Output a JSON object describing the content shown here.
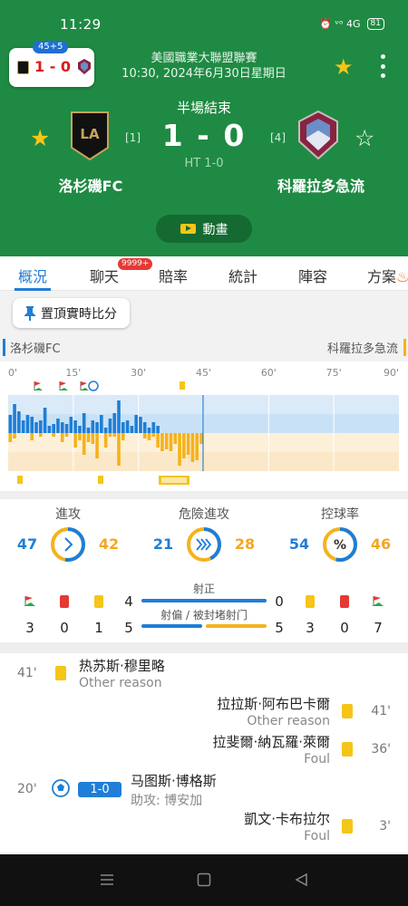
{
  "status_bar": {
    "time": "11:29",
    "icons": "⏰ ᵛᵒ 4G",
    "battery": "81"
  },
  "mini_card": {
    "badge": "45+5",
    "score": "1 - 0"
  },
  "match": {
    "competition": "美國職業大聯盟聯賽",
    "datetime": "10:30, 2024年6月30日星期日",
    "status": "半場結束",
    "score": "1 - 0",
    "halftime": "HT 1-0",
    "home": {
      "name": "洛杉磯FC",
      "rank": "[1]"
    },
    "away": {
      "name": "科羅拉多急流",
      "rank": "[4]"
    },
    "animation_label": "動畫"
  },
  "tabs": [
    "概況",
    "聊天",
    "賠率",
    "統計",
    "陣容",
    "方案"
  ],
  "chat_badge": "9999+",
  "pin_label": "置頂實時比分",
  "team_labels": {
    "home": "洛杉磯FC",
    "away": "科羅拉多急流"
  },
  "timeline_ticks": [
    "0'",
    "15'",
    "30'",
    "45'",
    "60'",
    "75'",
    "90'"
  ],
  "momentum": {
    "current_minute": 45,
    "home": [
      0.5,
      0.8,
      0.6,
      0.35,
      0.5,
      0.45,
      0.3,
      0.35,
      0.7,
      0.2,
      0.25,
      0.4,
      0.3,
      0.25,
      0.45,
      0.35,
      0.2,
      0.55,
      0.15,
      0.35,
      0.3,
      0.5,
      0.15,
      0.4,
      0.55,
      0.9,
      0.3,
      0.35,
      0.2,
      0.5,
      0.45,
      0.3,
      0.15,
      0.3,
      0.2,
      0,
      0,
      0,
      0,
      0,
      0,
      0,
      0,
      0,
      0
    ],
    "away": [
      0.25,
      0.15,
      0,
      0,
      0,
      0.2,
      0,
      0.1,
      0,
      0,
      0.1,
      0,
      0.25,
      0.1,
      0,
      0.4,
      0.2,
      0.6,
      0.25,
      0.3,
      0.7,
      0,
      0.4,
      0.1,
      0.1,
      0.9,
      0.2,
      0,
      0,
      0,
      0,
      0.15,
      0.2,
      0.1,
      0.4,
      0.5,
      0.45,
      0.5,
      0.3,
      0.9,
      0.7,
      0.6,
      0.8,
      0.75,
      0.3
    ]
  },
  "stats": {
    "attack": {
      "label": "進攻",
      "home": 47,
      "away": 42
    },
    "dangerous": {
      "label": "危險進攻",
      "home": 21,
      "away": 28
    },
    "possession": {
      "label": "控球率",
      "home": 54,
      "away": 46
    },
    "shots_on_target": {
      "label": "射正",
      "home": 4,
      "away": 0
    },
    "shots_off": {
      "label": "射偏 / 被封堵射门",
      "home": 5,
      "away": 5
    },
    "home_corners": 3,
    "home_red": 0,
    "home_yellow": 1,
    "away_yellow": 3,
    "away_red": 0,
    "away_corners": 7
  },
  "events": [
    {
      "minute": "41'",
      "name": "热苏斯·穆里略",
      "detail": "Other reason"
    },
    {
      "minute": "41'",
      "name": "拉拉斯·阿布巴卡爾",
      "detail": "Other reason"
    },
    {
      "minute": "36'",
      "name": "拉斐爾·納瓦羅·萊爾",
      "detail": "Foul"
    },
    {
      "minute": "20'",
      "name": "马图斯·博格斯",
      "detail": "助攻: 博安加",
      "score": "1-0"
    },
    {
      "minute": "3'",
      "name": "凱文·卡布拉尔",
      "detail": "Foul"
    }
  ],
  "colors": {
    "header": "#1f8a43",
    "home": "#1f7ed6",
    "away": "#f5b21c",
    "star": "#f5c518"
  }
}
